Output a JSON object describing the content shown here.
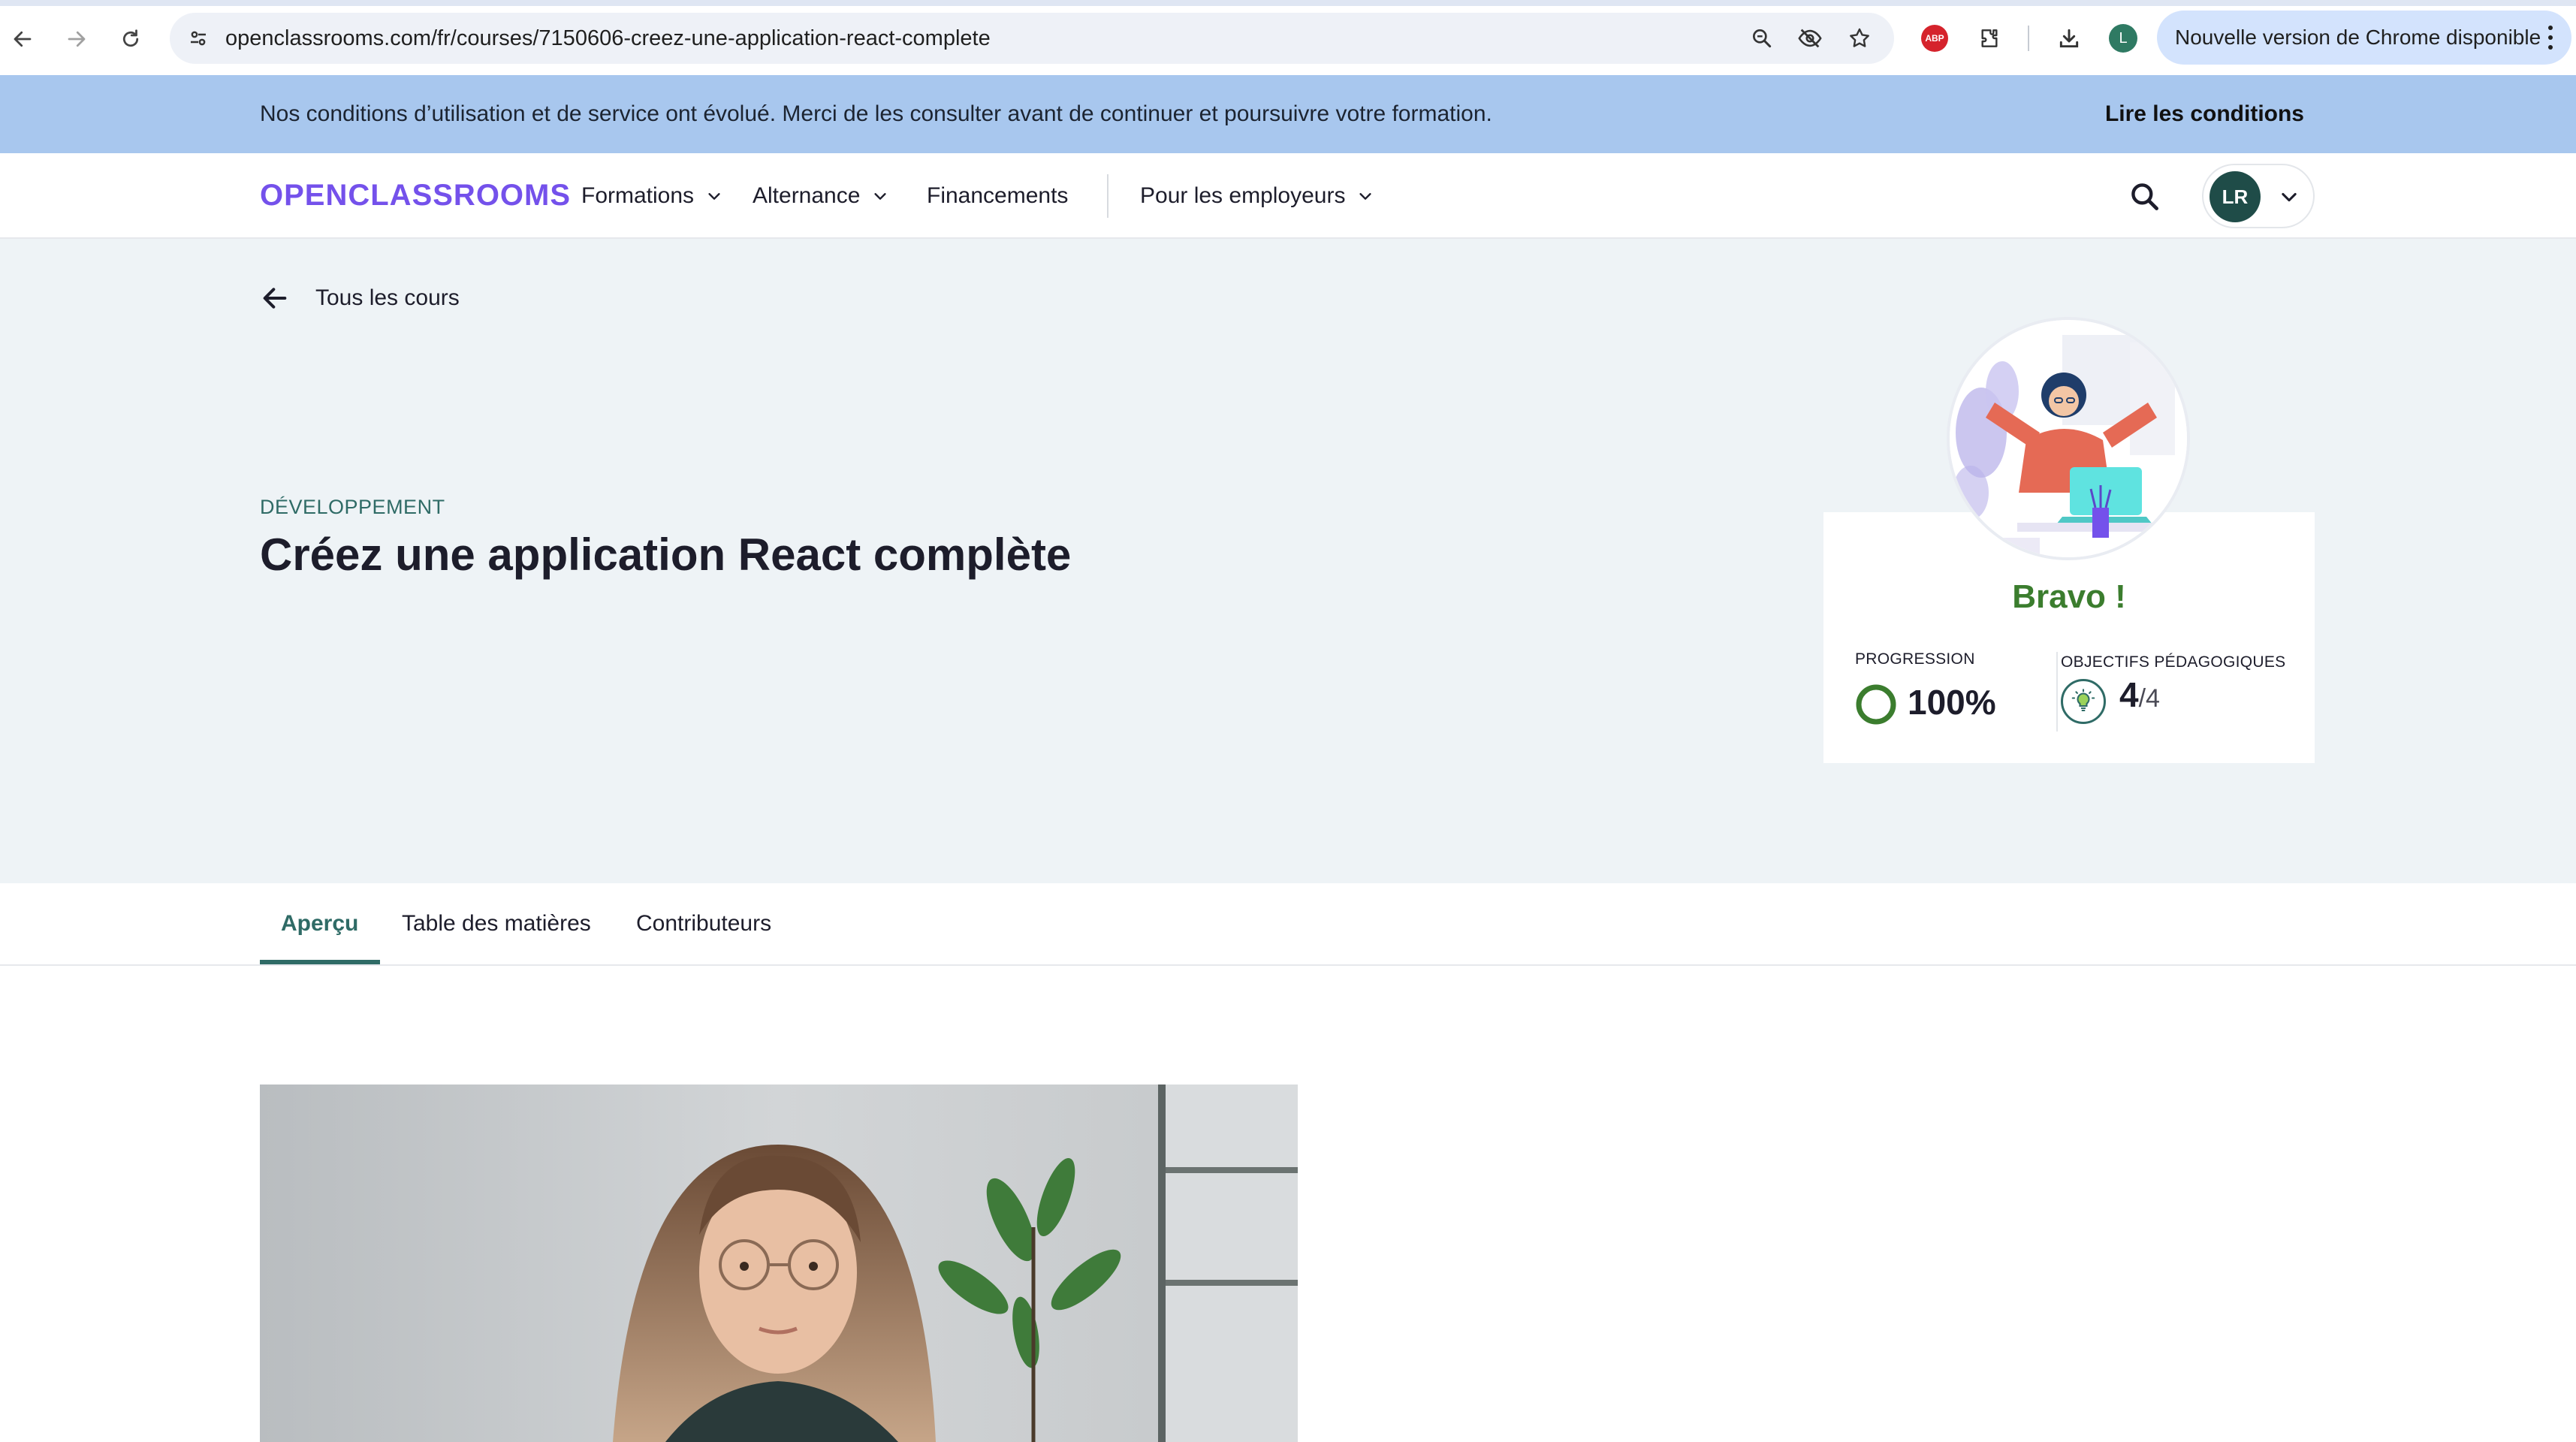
{
  "browser": {
    "url": "openclassrooms.com/fr/courses/7150606-creez-une-application-react-complete",
    "profile_initial": "L",
    "extension_abp": "ABP",
    "update_label": "Nouvelle version de Chrome disponible"
  },
  "notice": {
    "text": "Nos conditions d’utilisation et de service ont évolué. Merci de les consulter avant de continuer et poursuivre votre formation.",
    "link": "Lire les conditions"
  },
  "header": {
    "logo": "OPENCLASSROOMS",
    "menu": [
      {
        "label": "Formations"
      },
      {
        "label": "Alternance"
      },
      {
        "label": "Financements"
      },
      {
        "label": "Pour les employeurs"
      }
    ],
    "avatar_initials": "LR"
  },
  "hero": {
    "back_label": "Tous les cours",
    "category": "DÉVELOPPEMENT",
    "title": "Créez une application React complète"
  },
  "progress_card": {
    "headline": "Bravo !",
    "progress_label": "PROGRESSION",
    "progress_value": "100%",
    "progress_fraction": 1.0,
    "objectives_label": "OBJECTIFS PÉDAGOGIQUES",
    "objectives_done": "4",
    "objectives_total": "/4"
  },
  "tabs": [
    {
      "label": "Aperçu",
      "active": true
    },
    {
      "label": "Table des matières",
      "active": false
    },
    {
      "label": "Contributeurs",
      "active": false
    }
  ],
  "colors": {
    "brand": "#7451eb",
    "accent": "#2f6b66",
    "success": "#3b7d2e",
    "notice_bg": "#a8c7ee",
    "hero_bg": "#eef3f6"
  }
}
